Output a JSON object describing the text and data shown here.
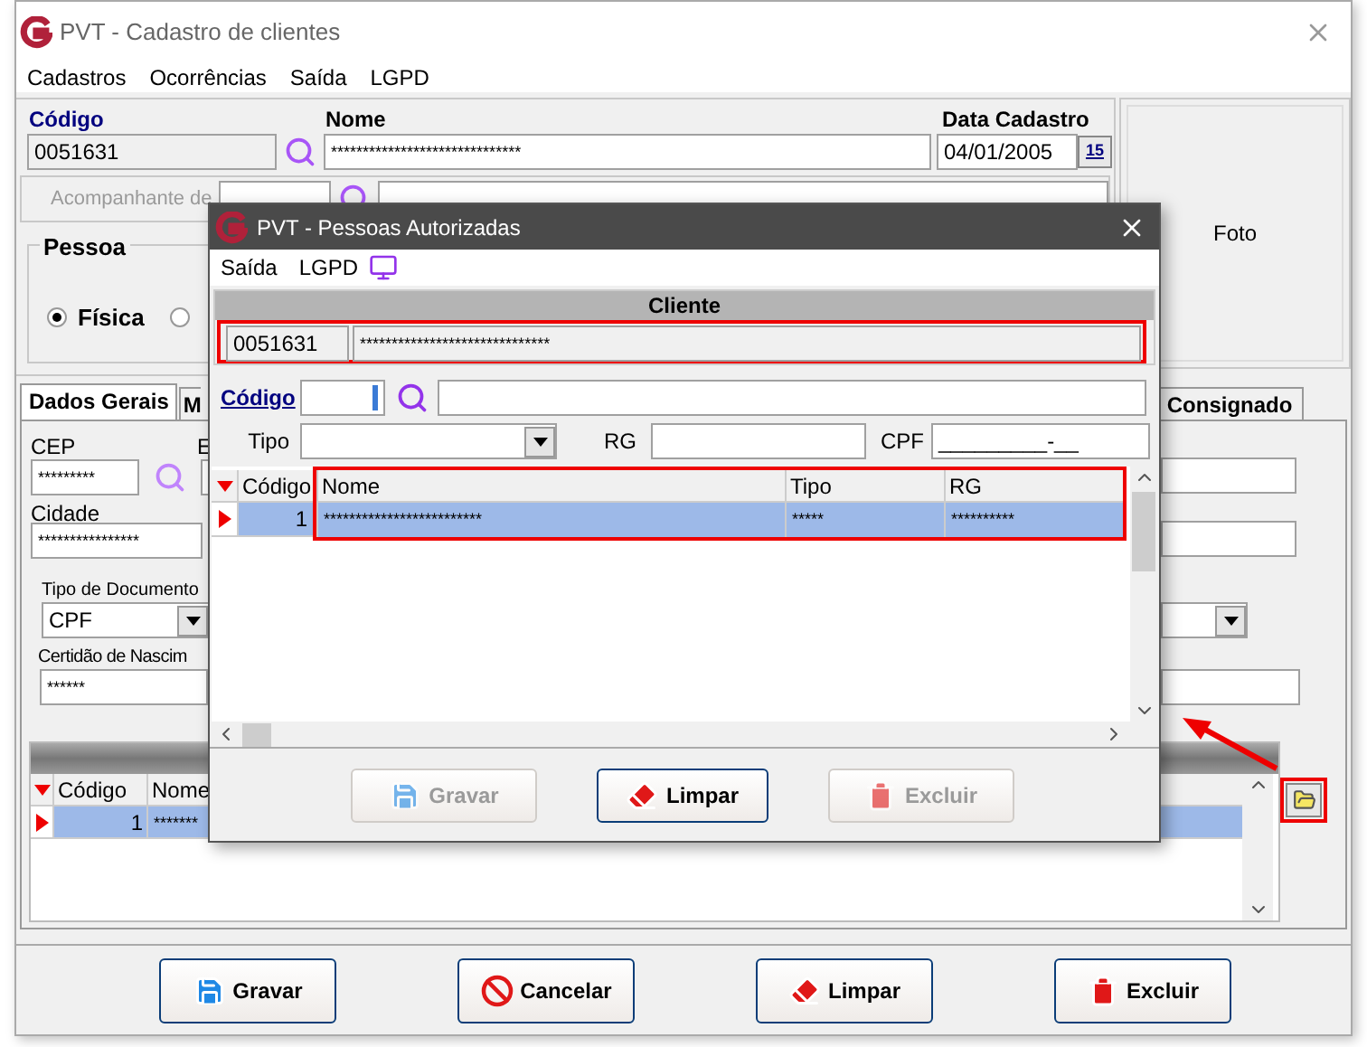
{
  "window": {
    "title": "PVT - Cadastro de clientes",
    "menu": [
      "Cadastros",
      "Ocorrências",
      "Saída",
      "LGPD"
    ]
  },
  "form": {
    "codigo_label": "Código",
    "codigo": "0051631",
    "nome_label": "Nome",
    "nome": "******************************",
    "data_label": "Data Cadastro",
    "data": "04/01/2005",
    "calendar_button": "15",
    "foto": "Foto",
    "acompanhante_label": "Acompanhante de",
    "acompanhante_disabled": true,
    "pessoa_label": "Pessoa",
    "pessoa_options": [
      {
        "label": "Física",
        "selected": true
      },
      {
        "selected": false
      }
    ]
  },
  "tabs": [
    {
      "label": "Dados Gerais",
      "selected": true
    },
    {
      "label": "M",
      "selected": false
    },
    {
      "label": "Consignado",
      "selected": false
    }
  ],
  "dados_gerais": {
    "cep_label": "CEP",
    "cep": "*********",
    "e_label": "E",
    "cidade_label": "Cidade",
    "cidade": "****************",
    "tipo_documento_label": "Tipo de Documento",
    "tipo_documento": "CPF",
    "certidao_label": "Certidão de Nascim",
    "certidao": "******"
  },
  "grid": {
    "columns": [
      "Código",
      "Nome"
    ],
    "rows": [
      {
        "codigo": "1",
        "nome": "*******",
        "selected": true
      }
    ]
  },
  "buttons": [
    {
      "label": "Gravar",
      "kind": "save",
      "disabled": false
    },
    {
      "label": "Cancelar",
      "kind": "cancel",
      "disabled": false
    },
    {
      "label": "Limpar",
      "kind": "clear",
      "disabled": false
    },
    {
      "label": "Excluir",
      "kind": "delete",
      "disabled": false
    }
  ],
  "dialog": {
    "title": "PVT - Pessoas Autorizadas",
    "menu": [
      "Saída",
      "LGPD"
    ],
    "cliente_header": "Cliente",
    "cliente_codigo": "0051631",
    "cliente_nome": "******************************",
    "codigo_label": "Código",
    "tipo_label": "Tipo",
    "rg_label": "RG",
    "cpf_label": "CPF",
    "cpf": "_________-__",
    "grid": {
      "columns": [
        "Código",
        "Nome",
        "Tipo",
        "RG"
      ],
      "rows": [
        {
          "codigo": "1",
          "nome": "*************************",
          "tipo": "*****",
          "rg": "**********",
          "selected": true
        }
      ]
    },
    "buttons": [
      {
        "label": "Gravar",
        "kind": "save",
        "disabled": true
      },
      {
        "label": "Limpar",
        "kind": "clear",
        "disabled": false
      },
      {
        "label": "Excluir",
        "kind": "delete",
        "disabled": true
      }
    ]
  }
}
